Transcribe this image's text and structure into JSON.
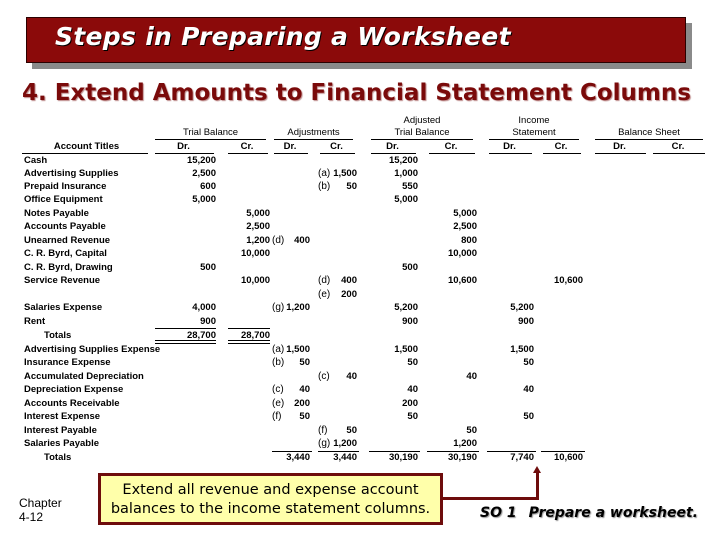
{
  "slide": {
    "title": "Steps in Preparing a Worksheet",
    "subtitle": "4. Extend Amounts to Financial Statement Columns",
    "chapter": [
      "Chapter",
      "4-12"
    ],
    "callout": [
      "Extend all revenue and expense account",
      "balances to the income statement columns."
    ],
    "objective_code": "SO 1",
    "objective_text": "Prepare a worksheet.",
    "colors": {
      "banner": "#8b0a0a",
      "subtitle": "#7a0a0a",
      "callout_bg": "#ffffaa",
      "callout_border": "#6e0c0c"
    }
  },
  "worksheet": {
    "headers": {
      "account_titles": "Account Titles",
      "groups": [
        {
          "line1": "",
          "line2": "Trial Balance"
        },
        {
          "line1": "",
          "line2": "Adjustments"
        },
        {
          "line1": "Adjusted",
          "line2": "Trial Balance"
        },
        {
          "line1": "Income",
          "line2": "Statement"
        },
        {
          "line1": "",
          "line2": "Balance Sheet"
        }
      ],
      "dr": "Dr.",
      "cr": "Cr."
    },
    "rows": [
      {
        "account": "Cash",
        "tb_dr": "15,200",
        "tb_cr": "",
        "adj_dr": "",
        "adj_cr": "",
        "atb_dr": "15,200",
        "atb_cr": "",
        "is_dr": "",
        "is_cr": "",
        "bs_dr": "",
        "bs_cr": ""
      },
      {
        "account": "Advertising Supplies",
        "tb_dr": "2,500",
        "tb_cr": "",
        "adj_dr": "",
        "adj_cr": "(a) 1,500",
        "atb_dr": "1,000",
        "atb_cr": "",
        "is_dr": "",
        "is_cr": "",
        "bs_dr": "",
        "bs_cr": ""
      },
      {
        "account": "Prepaid Insurance",
        "tb_dr": "600",
        "tb_cr": "",
        "adj_dr": "",
        "adj_cr": "(b) 50",
        "atb_dr": "550",
        "atb_cr": "",
        "is_dr": "",
        "is_cr": "",
        "bs_dr": "",
        "bs_cr": ""
      },
      {
        "account": "Office Equipment",
        "tb_dr": "5,000",
        "tb_cr": "",
        "adj_dr": "",
        "adj_cr": "",
        "atb_dr": "5,000",
        "atb_cr": "",
        "is_dr": "",
        "is_cr": "",
        "bs_dr": "",
        "bs_cr": ""
      },
      {
        "account": "Notes Payable",
        "tb_dr": "",
        "tb_cr": "5,000",
        "adj_dr": "",
        "adj_cr": "",
        "atb_dr": "",
        "atb_cr": "5,000",
        "is_dr": "",
        "is_cr": "",
        "bs_dr": "",
        "bs_cr": ""
      },
      {
        "account": "Accounts Payable",
        "tb_dr": "",
        "tb_cr": "2,500",
        "adj_dr": "",
        "adj_cr": "",
        "atb_dr": "",
        "atb_cr": "2,500",
        "is_dr": "",
        "is_cr": "",
        "bs_dr": "",
        "bs_cr": ""
      },
      {
        "account": "Unearned Revenue",
        "tb_dr": "",
        "tb_cr": "1,200",
        "adj_dr": "(d) 400",
        "adj_cr": "",
        "atb_dr": "",
        "atb_cr": "800",
        "is_dr": "",
        "is_cr": "",
        "bs_dr": "",
        "bs_cr": ""
      },
      {
        "account": "C. R. Byrd, Capital",
        "tb_dr": "",
        "tb_cr": "10,000",
        "adj_dr": "",
        "adj_cr": "",
        "atb_dr": "",
        "atb_cr": "10,000",
        "is_dr": "",
        "is_cr": "",
        "bs_dr": "",
        "bs_cr": ""
      },
      {
        "account": "C. R. Byrd, Drawing",
        "tb_dr": "500",
        "tb_cr": "",
        "adj_dr": "",
        "adj_cr": "",
        "atb_dr": "500",
        "atb_cr": "",
        "is_dr": "",
        "is_cr": "",
        "bs_dr": "",
        "bs_cr": ""
      },
      {
        "account": "Service Revenue",
        "tb_dr": "",
        "tb_cr": "10,000",
        "adj_dr": "",
        "adj_cr": "(d) 400",
        "atb_dr": "",
        "atb_cr": "10,600",
        "is_dr": "",
        "is_cr": "10,600",
        "bs_dr": "",
        "bs_cr": ""
      },
      {
        "account": "",
        "tb_dr": "",
        "tb_cr": "",
        "adj_dr": "",
        "adj_cr": "(e) 200",
        "atb_dr": "",
        "atb_cr": "",
        "is_dr": "",
        "is_cr": "",
        "bs_dr": "",
        "bs_cr": ""
      },
      {
        "account": "Salaries Expense",
        "tb_dr": "4,000",
        "tb_cr": "",
        "adj_dr": "(g)1,200",
        "adj_cr": "",
        "atb_dr": "5,200",
        "atb_cr": "",
        "is_dr": "5,200",
        "is_cr": "",
        "bs_dr": "",
        "bs_cr": ""
      },
      {
        "account": "Rent",
        "tb_dr": "900",
        "tb_cr": "",
        "adj_dr": "",
        "adj_cr": "",
        "atb_dr": "900",
        "atb_cr": "",
        "is_dr": "900",
        "is_cr": "",
        "bs_dr": "",
        "bs_cr": ""
      },
      {
        "account": "Totals",
        "tb_dr": "28,700",
        "tb_cr": "28,700",
        "adj_dr": "",
        "adj_cr": "",
        "atb_dr": "",
        "atb_cr": "",
        "is_dr": "",
        "is_cr": "",
        "bs_dr": "",
        "bs_cr": "",
        "total": true
      },
      {
        "account": "Advertising Supplies Expense",
        "tb_dr": "",
        "tb_cr": "",
        "adj_dr": "(a)1,500",
        "adj_cr": "",
        "atb_dr": "1,500",
        "atb_cr": "",
        "is_dr": "1,500",
        "is_cr": "",
        "bs_dr": "",
        "bs_cr": ""
      },
      {
        "account": "Insurance Expense",
        "tb_dr": "",
        "tb_cr": "",
        "adj_dr": "(b) 50",
        "adj_cr": "",
        "atb_dr": "50",
        "atb_cr": "",
        "is_dr": "50",
        "is_cr": "",
        "bs_dr": "",
        "bs_cr": ""
      },
      {
        "account": "Accumulated Depreciation",
        "tb_dr": "",
        "tb_cr": "",
        "adj_dr": "",
        "adj_cr": "(c) 40",
        "atb_dr": "",
        "atb_cr": "40",
        "is_dr": "",
        "is_cr": "",
        "bs_dr": "",
        "bs_cr": ""
      },
      {
        "account": "Depreciation Expense",
        "tb_dr": "",
        "tb_cr": "",
        "adj_dr": "(c) 40",
        "adj_cr": "",
        "atb_dr": "40",
        "atb_cr": "",
        "is_dr": "40",
        "is_cr": "",
        "bs_dr": "",
        "bs_cr": ""
      },
      {
        "account": "Accounts Receivable",
        "tb_dr": "",
        "tb_cr": "",
        "adj_dr": "(e) 200",
        "adj_cr": "",
        "atb_dr": "200",
        "atb_cr": "",
        "is_dr": "",
        "is_cr": "",
        "bs_dr": "",
        "bs_cr": ""
      },
      {
        "account": "Interest Expense",
        "tb_dr": "",
        "tb_cr": "",
        "adj_dr": "(f) 50",
        "adj_cr": "",
        "atb_dr": "50",
        "atb_cr": "",
        "is_dr": "50",
        "is_cr": "",
        "bs_dr": "",
        "bs_cr": ""
      },
      {
        "account": "Interest Payable",
        "tb_dr": "",
        "tb_cr": "",
        "adj_dr": "",
        "adj_cr": "(f) 50",
        "atb_dr": "",
        "atb_cr": "50",
        "is_dr": "",
        "is_cr": "",
        "bs_dr": "",
        "bs_cr": ""
      },
      {
        "account": "Salaries Payable",
        "tb_dr": "",
        "tb_cr": "",
        "adj_dr": "",
        "adj_cr": "(g) 1,200",
        "atb_dr": "",
        "atb_cr": "1,200",
        "is_dr": "",
        "is_cr": "",
        "bs_dr": "",
        "bs_cr": ""
      },
      {
        "account": "Totals",
        "tb_dr": "",
        "tb_cr": "",
        "adj_dr": "3,440",
        "adj_cr": "3,440",
        "atb_dr": "30,190",
        "atb_cr": "30,190",
        "is_dr": "7,740",
        "is_cr": "10,600",
        "bs_dr": "",
        "bs_cr": "",
        "total": true
      }
    ]
  }
}
